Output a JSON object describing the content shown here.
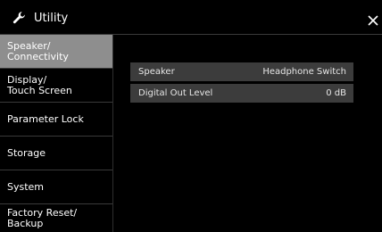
{
  "window": {
    "title": "Utility",
    "close_label": "×"
  },
  "sidebar": {
    "items": [
      {
        "lines": [
          "Speaker/",
          "Connectivity"
        ],
        "active": true
      },
      {
        "lines": [
          "Display/",
          "Touch Screen"
        ],
        "active": false
      },
      {
        "lines": [
          "Parameter Lock"
        ],
        "active": false
      },
      {
        "lines": [
          "Storage"
        ],
        "active": false
      },
      {
        "lines": [
          "System"
        ],
        "active": false
      },
      {
        "lines": [
          "Factory Reset/",
          "Backup"
        ],
        "active": false
      }
    ]
  },
  "settings": {
    "rows": [
      {
        "label": "Speaker",
        "value": "Headphone Switch"
      },
      {
        "label": "Digital Out Level",
        "value": "0 dB"
      }
    ]
  },
  "icons": {
    "title": "wrench-icon",
    "close": "close-icon"
  },
  "colors": {
    "background": "#000000",
    "active_tab": "#8e8e8e",
    "setting_row": "#3c3c3c",
    "divider": "#3a3a3a"
  }
}
